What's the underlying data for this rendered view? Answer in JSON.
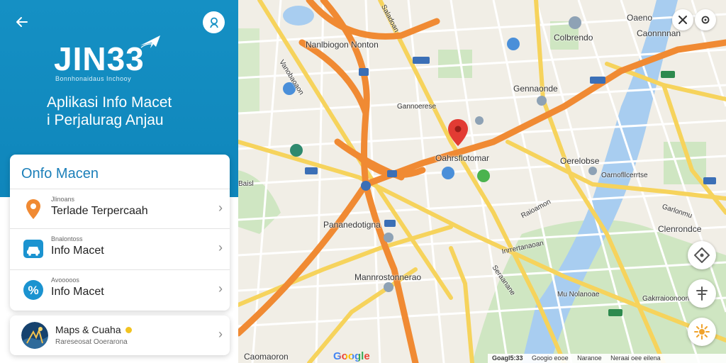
{
  "panel": {
    "logo_text": "JIN33",
    "logo_tagline": "Bonnhonaidaus Inchooy",
    "hero_title_line1": "Aplikasi Info Macet",
    "hero_title_line2": "i Perjalurag Anjau",
    "colors": {
      "brand": "#1590c4",
      "accent_orange": "#f08a33"
    }
  },
  "info_card": {
    "title": "Onfo Macen",
    "rows": [
      {
        "sub": "Jlinoans",
        "main": "Terlade Terpercaah",
        "icon": "location-pin-icon"
      },
      {
        "sub": "Bnalontoss",
        "main": "Info Macet",
        "icon": "car-icon"
      },
      {
        "sub": "Avooooos",
        "main": "Info Macet",
        "icon": "percent-icon"
      }
    ]
  },
  "maps_card": {
    "title": "Maps & Cuaha",
    "sub": "Rareseosat Ooerarona"
  },
  "map": {
    "labels": [
      "Nanlbiogon Nonton",
      "Gennaonde",
      "Gannoerese",
      "Oahrsflotomar",
      "Oerelobse",
      "Pananedotigna",
      "Mannrostonnerao",
      "Caomaoron",
      "Oarnofllcerrtse",
      "Clenrondce",
      "Colbrendo",
      "Oaeno",
      "Caonnnnan"
    ],
    "road_labels": [
      "Vanobaoaon",
      "Saladoan",
      "Garlonmu",
      "Baisl",
      "Inrrertanaoan",
      "Raioamon",
      "Seraanane",
      "Mu Nolanoae",
      "Gakrraioonoonte"
    ],
    "google": "Google",
    "scale_parts": [
      "Goagl5:33",
      "Googio eooe",
      "Naranoe",
      "Neraai oee eilena"
    ]
  }
}
